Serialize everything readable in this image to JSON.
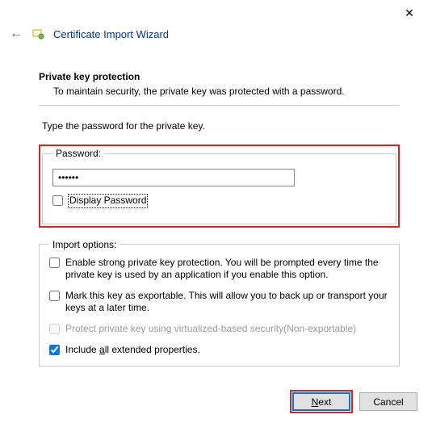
{
  "titlebar": {
    "close_glyph": "✕"
  },
  "header": {
    "back_glyph": "←",
    "title": "Certificate Import Wizard"
  },
  "section": {
    "title": "Private key protection",
    "desc": "To maintain security, the private key was protected with a password."
  },
  "instruction": "Type the password for the private key.",
  "password_group": {
    "legend": "Password:",
    "value": "••••••",
    "display_label": "Display Password"
  },
  "options_group": {
    "legend": "Import options:",
    "opt_strong": "Enable strong private key protection. You will be prompted every time the private key is used by an application if you enable this option.",
    "opt_exportable": "Mark this key as exportable. This will allow you to back up or transport your keys at a later time.",
    "opt_vbs": "Protect private key using virtualized-based security(Non-exportable)",
    "opt_include_prefix": "Include ",
    "opt_include_u": "a",
    "opt_include_suffix": "ll extended properties."
  },
  "footer": {
    "next_u": "N",
    "next_rest": "ext",
    "cancel": "Cancel"
  }
}
